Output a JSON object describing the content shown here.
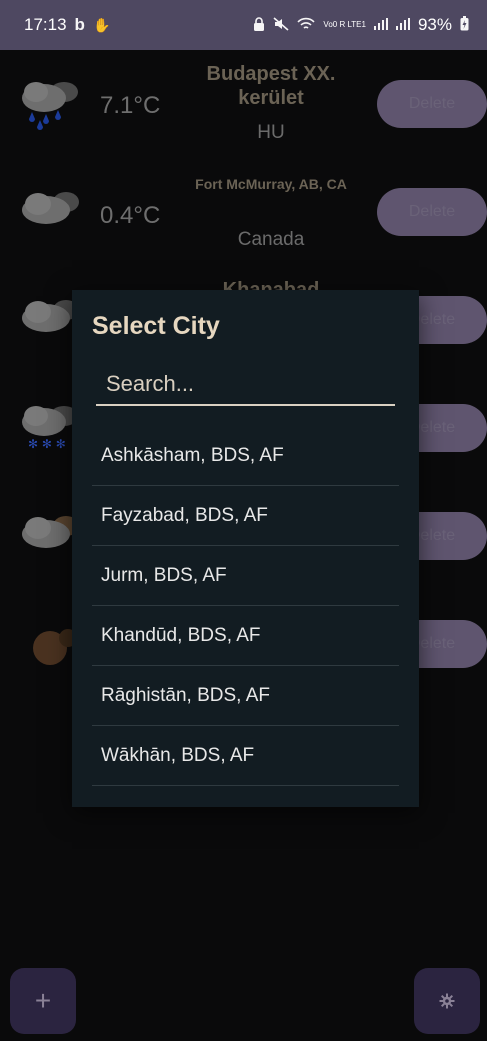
{
  "status_bar": {
    "time": "17:13",
    "left_icons": [
      "b-app-icon",
      "hand-icon"
    ],
    "right_icons": [
      "lock-icon",
      "mute-icon",
      "wifi-icon",
      "volte-icon",
      "signal-icon",
      "signal-icon",
      "battery-charging-icon"
    ],
    "volte_label": "Vo0 R LTE1",
    "battery": "93%"
  },
  "locations": [
    {
      "temp": "7.1°C",
      "city": "Budapest XX. kerület",
      "country": "HU",
      "icon": "rain-cloud-icon",
      "delete_label": "Delete"
    },
    {
      "temp": "0.4°C",
      "city": "Fort McMurray, AB, CA",
      "country": "Canada",
      "icon": "cloud-icon",
      "delete_label": "Delete"
    },
    {
      "temp": "",
      "city": "Khanabad",
      "country": "",
      "icon": "cloud-icon",
      "delete_label": "Delete"
    },
    {
      "temp": "",
      "city": "",
      "country": "",
      "icon": "snow-cloud-icon",
      "delete_label": "Delete"
    },
    {
      "temp": "",
      "city": "",
      "country": "",
      "icon": "cloud-icon",
      "delete_label": "Delete"
    },
    {
      "temp": "",
      "city": "",
      "country": "",
      "icon": "dark-cloud-icon",
      "delete_label": "Delete"
    }
  ],
  "dialog": {
    "title": "Select City",
    "search_placeholder": "Search...",
    "cities": [
      "Ashkāsham, BDS, AF",
      "Fayzabad, BDS, AF",
      "Jurm, BDS, AF",
      "Khandūd, BDS, AF",
      "Rāghistān, BDS, AF",
      "Wākhān, BDS, AF"
    ]
  },
  "fab_add": {
    "label": "+",
    "icon": "plus-icon"
  },
  "fab_settings": {
    "icon": "gear-icon"
  },
  "colors": {
    "accent": "#5f556f",
    "dialog_bg": "#121c22",
    "title": "#e6d7c0"
  }
}
